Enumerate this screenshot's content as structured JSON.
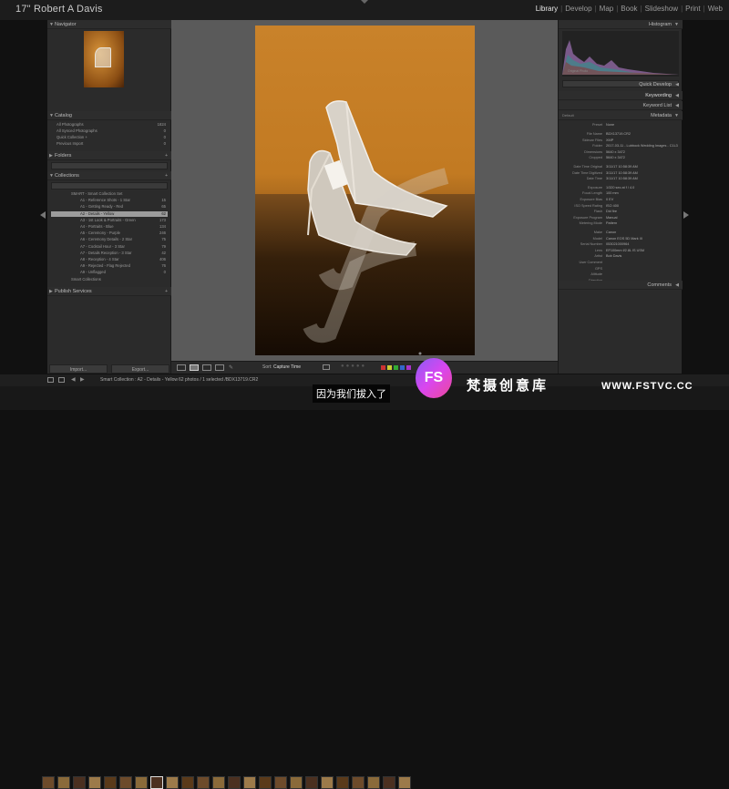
{
  "identity": "17\" Robert A Davis",
  "modules": [
    "Library",
    "Develop",
    "Map",
    "Book",
    "Slideshow",
    "Print",
    "Web"
  ],
  "active_module": "Library",
  "left": {
    "navigator": "Navigator",
    "catalog": "Catalog",
    "catalog_items": [
      {
        "label": "All Photographs",
        "count": "1824"
      },
      {
        "label": "All Synced Photographs",
        "count": "0"
      },
      {
        "label": "Quick Collection +",
        "count": "0"
      },
      {
        "label": "Previous Import",
        "count": "0"
      }
    ],
    "folders": "Folders",
    "folders_filter": "Filter Folders",
    "collections": "Collections",
    "collection_items": [
      {
        "label": "SMART - Smart Collection Set",
        "count": ""
      },
      {
        "label": "A1 - Reference Shots - 1 Star",
        "count": "15"
      },
      {
        "label": "A1 - Getting Ready - Red",
        "count": "65"
      },
      {
        "label": "A2 - Details - Yellow",
        "count": "62"
      },
      {
        "label": "A3 - 1st Look & Portraits - Green",
        "count": "173"
      },
      {
        "label": "A4 - Portraits - Blue",
        "count": "134"
      },
      {
        "label": "A5 - Ceremony - Purple",
        "count": "246"
      },
      {
        "label": "A6 - Ceremony Details - 2 Star",
        "count": "75"
      },
      {
        "label": "A7 - Cocktail Hour - 3 Star",
        "count": "79"
      },
      {
        "label": "A7 - Details Reception - 3 Star",
        "count": "42"
      },
      {
        "label": "A8 - Reception - 4 Star",
        "count": "406"
      },
      {
        "label": "A9 - Rejected - Flag Rejected",
        "count": "76"
      },
      {
        "label": "A9 - Unflagged",
        "count": "0"
      },
      {
        "label": "Smart Collections",
        "count": ""
      }
    ],
    "publish": "Publish Services",
    "import_btn": "Import...",
    "export_btn": "Export..."
  },
  "right": {
    "histogram": "Histogram",
    "original_photo": "Original Photo",
    "quick_develop": "Quick Develop",
    "keywording": "Keywording",
    "keyword_list": "Keyword List",
    "metadata": "Metadata",
    "preset": "Preset",
    "preset_value": "None",
    "default": "Default",
    "meta_rows": [
      {
        "k": "File Name",
        "v": "BDX13719.CR2"
      },
      {
        "k": "Sidecar Files",
        "v": "XMP"
      },
      {
        "k": "Folder",
        "v": "2017-03-11 - Lubbock Wedding Images - C1L3"
      },
      {
        "k": "Dimensions",
        "v": "5640 x 3472"
      },
      {
        "k": "Cropped",
        "v": "5640 x 3472"
      },
      {
        "k": "Date Time Original",
        "v": "3/11/17 10:58:39 AM"
      },
      {
        "k": "Date Time Digitized",
        "v": "3/11/17 10:58:39 AM"
      },
      {
        "k": "Date Time",
        "v": "3/11/17 10:58:39 AM"
      },
      {
        "k": "Exposure",
        "v": "1/320 sec at f / 4.0"
      },
      {
        "k": "Focal Length",
        "v": "100 mm"
      },
      {
        "k": "Exposure Bias",
        "v": "0 EV"
      },
      {
        "k": "ISO Speed Rating",
        "v": "ISO 400"
      },
      {
        "k": "Flash",
        "v": "Did fire"
      },
      {
        "k": "Exposure Program",
        "v": "Manual"
      },
      {
        "k": "Metering Mode",
        "v": "Pattern"
      },
      {
        "k": "Make",
        "v": "Canon"
      },
      {
        "k": "Model",
        "v": "Canon EOS 5D Mark III"
      },
      {
        "k": "Serial Number",
        "v": "053021000964"
      },
      {
        "k": "Lens",
        "v": "EF100mm f/2.8L IS USM"
      },
      {
        "k": "Artist",
        "v": "Bob Davis"
      },
      {
        "k": "User Comment",
        "v": ""
      },
      {
        "k": "GPS",
        "v": ""
      },
      {
        "k": "Altitude",
        "v": ""
      },
      {
        "k": "Direction",
        "v": ""
      }
    ],
    "comments": "Comments"
  },
  "toolbar": {
    "sort_label": "Sort:",
    "sort_value": "Capture Time"
  },
  "filmbar": {
    "path": "Smart Collection : A2 - Details - Yellow",
    "count": "62 photos / 1 selected /BDX13719.CR2"
  },
  "overlay": {
    "subtitle": "因为我们拔入了",
    "brand": "梵摄创意库",
    "logo": "FS",
    "watermark": "WWW.FSTVC.CC"
  }
}
